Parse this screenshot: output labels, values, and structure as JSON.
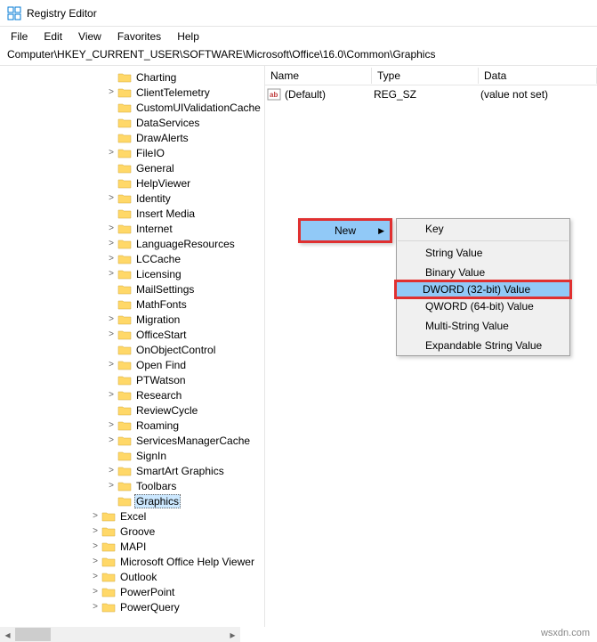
{
  "window": {
    "title": "Registry Editor"
  },
  "menu": {
    "file": "File",
    "edit": "Edit",
    "view": "View",
    "favorites": "Favorites",
    "help": "Help"
  },
  "address": "Computer\\HKEY_CURRENT_USER\\SOFTWARE\\Microsoft\\Office\\16.0\\Common\\Graphics",
  "list": {
    "headers": {
      "name": "Name",
      "type": "Type",
      "data": "Data"
    },
    "rows": [
      {
        "name": "(Default)",
        "type": "REG_SZ",
        "data": "(value not set)"
      }
    ]
  },
  "tree": [
    {
      "label": "Charting",
      "depth": 1,
      "exp": ""
    },
    {
      "label": "ClientTelemetry",
      "depth": 1,
      "exp": ">"
    },
    {
      "label": "CustomUIValidationCache",
      "depth": 1,
      "exp": ""
    },
    {
      "label": "DataServices",
      "depth": 1,
      "exp": ""
    },
    {
      "label": "DrawAlerts",
      "depth": 1,
      "exp": ""
    },
    {
      "label": "FileIO",
      "depth": 1,
      "exp": ">"
    },
    {
      "label": "General",
      "depth": 1,
      "exp": ""
    },
    {
      "label": "HelpViewer",
      "depth": 1,
      "exp": ""
    },
    {
      "label": "Identity",
      "depth": 1,
      "exp": ">"
    },
    {
      "label": "Insert Media",
      "depth": 1,
      "exp": ""
    },
    {
      "label": "Internet",
      "depth": 1,
      "exp": ">"
    },
    {
      "label": "LanguageResources",
      "depth": 1,
      "exp": ">"
    },
    {
      "label": "LCCache",
      "depth": 1,
      "exp": ">"
    },
    {
      "label": "Licensing",
      "depth": 1,
      "exp": ">"
    },
    {
      "label": "MailSettings",
      "depth": 1,
      "exp": ""
    },
    {
      "label": "MathFonts",
      "depth": 1,
      "exp": ""
    },
    {
      "label": "Migration",
      "depth": 1,
      "exp": ">"
    },
    {
      "label": "OfficeStart",
      "depth": 1,
      "exp": ">"
    },
    {
      "label": "OnObjectControl",
      "depth": 1,
      "exp": ""
    },
    {
      "label": "Open Find",
      "depth": 1,
      "exp": ">"
    },
    {
      "label": "PTWatson",
      "depth": 1,
      "exp": ""
    },
    {
      "label": "Research",
      "depth": 1,
      "exp": ">"
    },
    {
      "label": "ReviewCycle",
      "depth": 1,
      "exp": ""
    },
    {
      "label": "Roaming",
      "depth": 1,
      "exp": ">"
    },
    {
      "label": "ServicesManagerCache",
      "depth": 1,
      "exp": ">"
    },
    {
      "label": "SignIn",
      "depth": 1,
      "exp": ""
    },
    {
      "label": "SmartArt Graphics",
      "depth": 1,
      "exp": ">"
    },
    {
      "label": "Toolbars",
      "depth": 1,
      "exp": ">"
    },
    {
      "label": "Graphics",
      "depth": 1,
      "exp": "",
      "selected": true
    },
    {
      "label": "Excel",
      "depth": 0,
      "exp": ">"
    },
    {
      "label": "Groove",
      "depth": 0,
      "exp": ">"
    },
    {
      "label": "MAPI",
      "depth": 0,
      "exp": ">"
    },
    {
      "label": "Microsoft Office Help Viewer",
      "depth": 0,
      "exp": ">"
    },
    {
      "label": "Outlook",
      "depth": 0,
      "exp": ">"
    },
    {
      "label": "PowerPoint",
      "depth": 0,
      "exp": ">"
    },
    {
      "label": "PowerQuery",
      "depth": 0,
      "exp": ">"
    }
  ],
  "ctx1": {
    "new": "New"
  },
  "ctx2": {
    "key": "Key",
    "string": "String Value",
    "binary": "Binary Value",
    "dword": "DWORD (32-bit) Value",
    "qword": "QWORD (64-bit) Value",
    "multi": "Multi-String Value",
    "expand": "Expandable String Value"
  },
  "watermark": "wsxdn.com"
}
